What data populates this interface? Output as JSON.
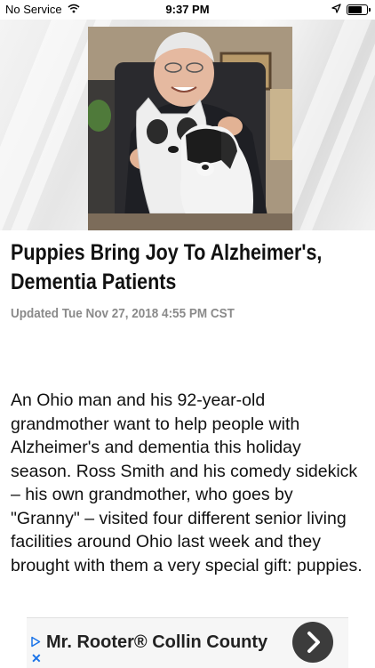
{
  "status_bar": {
    "carrier": "No Service",
    "time": "9:37 PM",
    "icons": [
      "wifi-icon",
      "location-arrow-icon",
      "battery-icon"
    ]
  },
  "hero": {
    "image": "photo-elderly-man-with-puppy-and-dog-pillow"
  },
  "article": {
    "title": "Puppies Bring Joy To Alzheimer's, Dementia Patients",
    "updated": "Updated Tue Nov 27, 2018 4:55 PM CST",
    "body": "An Ohio man and his 92-year-old grandmother want to help people with Alzheimer's and dementia this holiday season. Ross Smith and his comedy sidekick – his own grandmother, who goes by \"Granny\" – visited four different senior living facilities around Ohio last week and they brought with them a very special gift: puppies."
  },
  "ad": {
    "title": "Mr. Rooter® Collin County",
    "icons": [
      "ad-choices-icon",
      "ad-close-icon",
      "chevron-right-icon"
    ],
    "colors": {
      "ad_icon": "#1a73e8",
      "go_button": "#3c3c3c"
    }
  }
}
